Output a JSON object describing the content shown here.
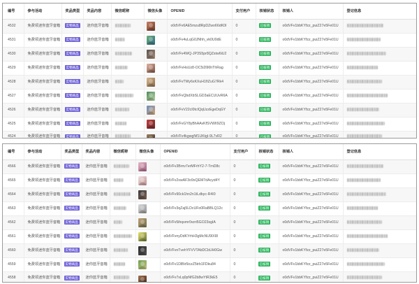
{
  "tables": [
    {
      "headers": [
        "编号",
        "参与活动",
        "奖品类型",
        "奖品内容",
        "微信昵称",
        "微信头像",
        "OPENID",
        "支付用户",
        "核销状态",
        "核销人",
        "登记信息"
      ],
      "rows": [
        {
          "id": "4532",
          "activity": "免费领迷你蓝牙音箱",
          "prize_type": "实物商品",
          "prize": "迷你蓝牙音箱",
          "avatar": [
            "#c9805f",
            "#6e3a2c"
          ],
          "openid": "o0dVFv6AE5mzu8RpDZwo66dK0I",
          "paid": "0",
          "status": "已核销",
          "verifier": "o0dVFv1bbKYfzz_puiZ27e5Fe01U"
        },
        {
          "id": "4531",
          "activity": "免费领迷你蓝牙音箱",
          "prize_type": "实物商品",
          "prize": "迷你蓝牙音箱",
          "avatar": [
            "#6fb07a",
            "#2f6a88"
          ],
          "openid": "o0dVFv4uLqG0JNhh_vk0U0dE",
          "paid": "0",
          "status": "已核销",
          "verifier": "o0dVFv1bbKYfzz_puiZ27e5Fe01U"
        },
        {
          "id": "4530",
          "activity": "免费领迷你蓝牙音箱",
          "prize_type": "实物商品",
          "prize": "迷你蓝牙音箱",
          "avatar": [
            "#5a5350",
            "#a88c76"
          ],
          "openid": "o0dVFv4WQ-JP3S5pr8QZstw6iU2",
          "paid": "0",
          "status": "已核销",
          "verifier": "o0dVFv1bbKYfzz_puiZ27e5Fe01U"
        },
        {
          "id": "4529",
          "activity": "免费领迷你蓝牙音箱",
          "prize_type": "实物商品",
          "prize": "迷你蓝牙音箱",
          "avatar": [
            "#e2b3a2",
            "#7c5242"
          ],
          "openid": "o0dVFvHsUz8-OC5i2l96hThRag",
          "paid": "0",
          "status": "已核销",
          "verifier": "o0dVFv1bbKYfzz_puiZ27e5Fe01U"
        },
        {
          "id": "4528",
          "activity": "免费领迷你蓝牙音箱",
          "prize_type": "实物商品",
          "prize": "迷你蓝牙音箱",
          "avatar": [
            "#d8b68c",
            "#8a6a4a"
          ],
          "openid": "o0dVFvTWy6xKXuH1fIZuG7Rk4",
          "paid": "0",
          "status": "已核销",
          "verifier": "o0dVFv1bbKYfzz_puiZ27e5Fe01U"
        },
        {
          "id": "4527",
          "activity": "免费领迷你蓝牙音箱",
          "prize_type": "实物商品",
          "prize": "迷你蓝牙音箱",
          "avatar": [
            "#4f8a5a",
            "#b8d2a2"
          ],
          "openid": "o0dVFvQbdXbSLGD3aECUUvR6A",
          "paid": "0",
          "status": "已核销",
          "verifier": "o0dVFv1bbKYfzz_puiZ27e5Fe01U"
        },
        {
          "id": "4526",
          "activity": "免费领迷你蓝牙音箱",
          "prize_type": "实物商品",
          "prize": "迷你蓝牙音箱",
          "avatar": [
            "#6a8fc0",
            "#d2a272"
          ],
          "openid": "o0dVFvV22cI0tcIQqUzzEgeDqGY",
          "paid": "0",
          "status": "已核销",
          "verifier": "o0dVFv1bbKYfzz_puiZ27e5Fe01U"
        },
        {
          "id": "4525",
          "activity": "免费领迷你蓝牙音箱",
          "prize_type": "实物商品",
          "prize": "迷你蓝牙音箱",
          "avatar": [
            "#c23c3c",
            "#6a2a2a"
          ],
          "openid": "o0dVFvGY8yBhAAvKfSVWII9ZOj",
          "paid": "0",
          "status": "已核销",
          "verifier": "o0dVFv1bbKYfzz_puiZ27e5Fe01U"
        },
        {
          "id": "4524",
          "activity": "免费领迷你蓝牙音箱",
          "prize_type": "实物商品",
          "prize": "迷你蓝牙音箱",
          "avatar": [
            "#a08060",
            "#504030"
          ],
          "openid": "o0dVFv4kgwgNf1UKtgl-9L7vR2",
          "paid": "0",
          "status": "已核销",
          "verifier": "o0dVFv1bbKYfzz_puiZ27e5Fe01U"
        }
      ]
    },
    {
      "headers": [
        "编号",
        "参与活动",
        "奖品类型",
        "奖品内容",
        "微信昵称",
        "微信头像",
        "OPENID",
        "支付用户",
        "核销状态",
        "核销人",
        "登记信息"
      ],
      "rows": [
        {
          "id": "4566",
          "activity": "免费领迷你蓝牙音箱",
          "prize_type": "实物商品",
          "prize": "迷你蓝牙音箱",
          "avatar": [
            "#e8b8c8",
            "#a06080"
          ],
          "openid": "o0dVFv3Brnv7erMFrhY2-7-TrnD8c",
          "paid": "0",
          "status": "已核销",
          "verifier": "o0dVFv1bbKYfzz_puiZ27e5Fe01U"
        },
        {
          "id": "4565",
          "activity": "免费领迷你蓝牙音箱",
          "prize_type": "实物商品",
          "prize": "迷你蓝牙音箱",
          "avatar": [
            "#f0e0e0",
            "#c09090"
          ],
          "openid": "o0dVFv2xwAF3o9xQEM7dAcyd4Y",
          "paid": "0",
          "status": "已核销",
          "verifier": "o0dVFv1bbKYfzz_puiZ27e5Fe01U"
        },
        {
          "id": "4564",
          "activity": "免费领迷你蓝牙音箱",
          "prize_type": "实物商品",
          "prize": "迷你蓝牙音箱",
          "avatar": [
            "#3a3a3a",
            "#806050"
          ],
          "openid": "o0dVFv90ck1hn2n1tLdbyc-R4I0",
          "paid": "0",
          "status": "已核销",
          "verifier": "o0dVFv1bbKYfzz_puiZ27e5Fe01U"
        },
        {
          "id": "4563",
          "activity": "免费领迷你蓝牙音箱",
          "prize_type": "实物商品",
          "prize": "迷你蓝牙音箱",
          "avatar": [
            "#dadada",
            "#909090"
          ],
          "openid": "o0dVFv3qZaj5LDcUFo0RaBBLQ12c",
          "paid": "0",
          "status": "已核销",
          "verifier": "o0dVFv1bbKYfzz_puiZ27e5Fe01U"
        },
        {
          "id": "4562",
          "activity": "免费领迷你蓝牙音箱",
          "prize_type": "实物商品",
          "prize": "迷你蓝牙音箱",
          "avatar": [
            "#c0a070",
            "#707050"
          ],
          "openid": "o0dVFv5ihqsmr0vzri5GO23sgIA",
          "paid": "0",
          "status": "已核销",
          "verifier": "o0dVFv1bbKYfzz_puiZ27e5Fe01U"
        },
        {
          "id": "4561",
          "activity": "免费领迷你蓝牙音箱",
          "prize_type": "实物商品",
          "prize": "迷你蓝牙音箱",
          "avatar": [
            "#e8e070",
            "#607030"
          ],
          "openid": "o0dVFvnyDdKYrhH3gMcNU9IXI8",
          "paid": "0",
          "status": "已核销",
          "verifier": "o0dVFv1bbKYfzz_puiZ27e5Fe01U"
        },
        {
          "id": "4560",
          "activity": "免费领迷你蓝牙音箱",
          "prize_type": "实物商品",
          "prize": "迷你蓝牙音箱",
          "avatar": [
            "#2a2a2a",
            "#555555"
          ],
          "openid": "o0dVFvnTvehYFVVTAbDCbUH0Gw",
          "paid": "0",
          "status": "已核销",
          "verifier": "o0dVFv1bbKYfzz_puiZ27e5Fe01U"
        },
        {
          "id": "4559",
          "activity": "免费领迷你蓝牙音箱",
          "prize_type": "实物商品",
          "prize": "迷你蓝牙音箱",
          "avatar": [
            "#70a050",
            "#c0c080"
          ],
          "openid": "o0dVFv1DlBir5iczZ5trb1FDku84",
          "paid": "0",
          "status": "已核销",
          "verifier": "o0dVFv1bbKYfzz_puiZ27e5Fe01U"
        },
        {
          "id": "4558",
          "activity": "免费领迷你蓝牙音箱",
          "prize_type": "实物商品",
          "prize": "迷你蓝牙音箱",
          "avatar": [
            "#a07050",
            "#503020"
          ],
          "openid": "o0dVFv7xLq0pNfG2b8wYtR3kE5",
          "paid": "0",
          "status": "已核销",
          "verifier": "o0dVFv1bbKYfzz_puiZ27e5Fe01U"
        }
      ]
    }
  ],
  "colors": {
    "prize_badge": "#6d61d6",
    "status_badge": "#2db55d",
    "text": "#555555",
    "header_text": "#333333"
  }
}
